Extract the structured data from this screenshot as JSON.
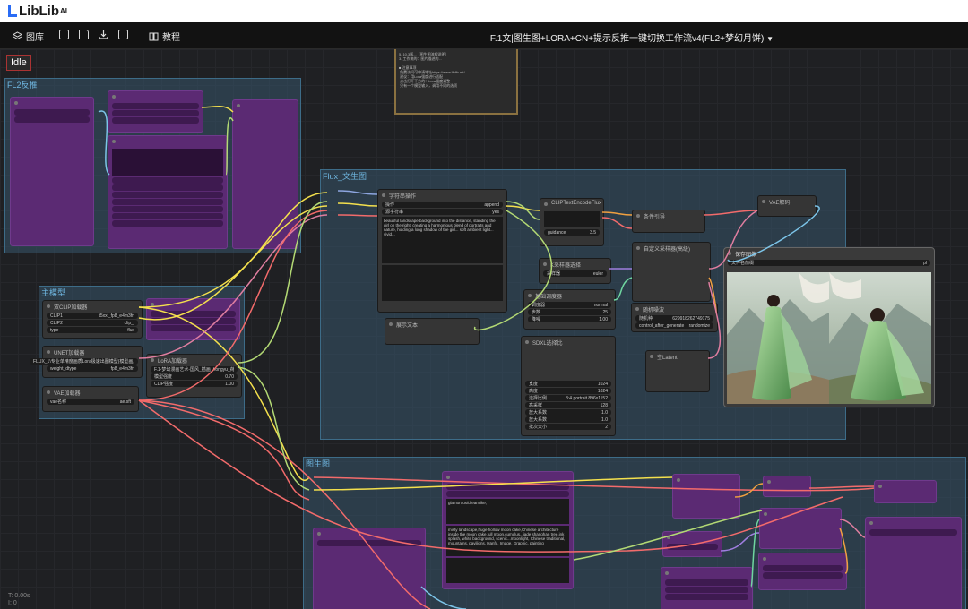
{
  "brand": {
    "name": "LibLib",
    "suffix": "AI"
  },
  "toolbar": {
    "library_label": "图库",
    "tutorial_label": "教程",
    "workflow_title": "F.1文|图生图+LORA+CN+提示反推一键切换工作流v4(FL2+梦幻月饼)"
  },
  "canvas": {
    "status_badge": "Idle",
    "status_lines": [
      "T: 0.00s",
      "I: 0"
    ]
  },
  "note_text": "5. 10.3版...（图生图流程说明）\n3. 工作流的：图片描述的...\n\n■ 注意事项\n 免费访问可申请地址https://www.liblib.art/\n 建议：用Lora强度进行适配\n 点击打开下方的：Lora强度调整\n 只有一个模型输入，调用不同的选项",
  "groups": {
    "fl2": "FL2反推",
    "main_model": "主模型",
    "flux_t2i": "Flux_文生图",
    "i2i": "图生图"
  },
  "nodes": {
    "string_op": {
      "title": "字符串操作",
      "w1_label": "操作",
      "w1_value": "append",
      "w2_label": "源字符串",
      "w2_value": "yes"
    },
    "prompt_text": "beautiful landscape background into the distance, standing the girl on the right, creating a harmonious blend of portraits and nature, holding a long shadow of the girl...\nsoft ambient light...\nvivid...",
    "show_text": {
      "title": "展示文本"
    },
    "clip_encode": {
      "title": "CLIPTextEncodeFlux",
      "guidance_label": "guidance",
      "guidance_value": "3.5"
    },
    "conditioning": {
      "title": "条件引导"
    },
    "k_sampler_select": {
      "title": "K采样器选择",
      "sampler_label": "采样器",
      "sampler_value": "euler"
    },
    "basic_scheduler": {
      "title": "基础调度器",
      "rows": [
        [
          "调度器",
          "normal"
        ],
        [
          "步数",
          "25"
        ],
        [
          "降噪",
          "1.00"
        ]
      ]
    },
    "custom_sampler": {
      "title": "自定义采样器(高级)"
    },
    "random_noise": {
      "title": "随机噪波",
      "rows": [
        [
          "随机种",
          "629918262749175"
        ],
        [
          "control_after_generate",
          "randomize"
        ]
      ]
    },
    "sdxl_res": {
      "title": "SDXL选择比",
      "rows": [
        [
          "宽度",
          "1024"
        ],
        [
          "高度",
          "1024"
        ],
        [
          "选择比例",
          "3:4 portrait 896x1152"
        ],
        [
          "高采样",
          "128"
        ],
        [
          "放大系数",
          "1.0"
        ],
        [
          "放大系数",
          "1.0"
        ],
        [
          "批次大小",
          "2"
        ]
      ]
    },
    "empty_latent": {
      "title": "空Latent"
    },
    "vae_decode": {
      "title": "VAE解码"
    },
    "save_image": {
      "title": "保存图像",
      "prefix_label": "文件名前缀",
      "prefix_value": "pl"
    },
    "dual_clip": {
      "title": "双CLIP加载器",
      "rows": [
        [
          "CLIP1",
          "t5xxl_fp8_e4m3fn"
        ],
        [
          "CLIP2",
          "clip_l"
        ],
        [
          "type",
          "flux"
        ]
      ]
    },
    "unet": {
      "title": "UNET加载器",
      "rows": [
        [
          "FLUX_1\\专业单精度画质Lora极速出图模型(模型画质优化工作室_FLUX.1-dev-fp8",
          ""
        ],
        [
          "weight_dtype",
          "fp8_e4m3fn"
        ]
      ]
    },
    "vae_loader": {
      "title": "VAE加载器",
      "rows": [
        [
          "vae名称",
          "ae.sft"
        ]
      ]
    },
    "lora_loader": {
      "title": "LoRA加载器",
      "rows": [
        [
          "Lora名称",
          "F.1-梦幻漫画艺术-国风_插画_hongyu_荷鲜梦"
        ],
        [
          "模型强度",
          "0.70"
        ],
        [
          "CLIP强度",
          "1.00"
        ]
      ]
    },
    "i2i_prompt": "glamorous/dreamlike,",
    "i2i_desc": "misty landscape,huge hollow moon cake,Chinese architecture inside the moon cake,full moon,cumulus...jade shanghan tree,ink splash, white background, scenic...moonlight, Chinese traditional, mountains, pavilions, Hanfu. Image. Graphic, painting"
  }
}
